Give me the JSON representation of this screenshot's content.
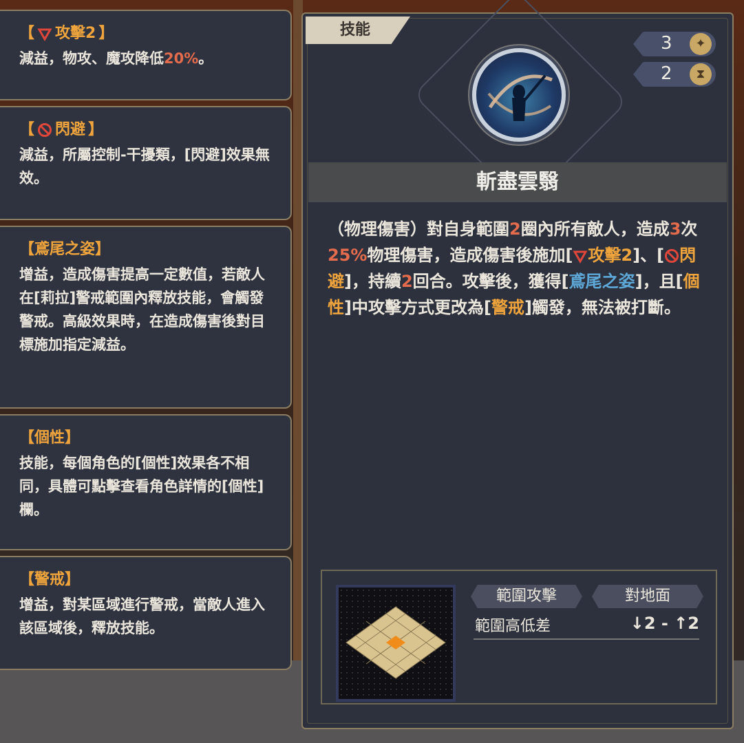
{
  "tooltips": [
    {
      "title_pre": "【",
      "title": "攻擊2",
      "title_post": "】",
      "icon": "down-triangle-icon",
      "body_a": "減益，物攻、魔攻降低",
      "body_hl": "20%",
      "body_b": "。"
    },
    {
      "title_pre": "【",
      "title": "閃避",
      "title_post": "】",
      "icon": "prohibit-icon",
      "body": "減益，所屬控制-干擾類，[閃避]效果無效。"
    },
    {
      "title": "【鳶尾之姿】",
      "body": "增益，造成傷害提高一定數值，若敵人在[莉拉]警戒範圍內釋放技能，會觸發警戒。高級效果時，在造成傷害後對目標施加指定減益。"
    },
    {
      "title": "【個性】",
      "body": "技能，每個角色的[個性]效果各不相同，具體可點擊查看角色詳情的[個性]欄。"
    },
    {
      "title": "【警戒】",
      "body": "增益，對某區域進行警戒，當敵人進入該區域後，釋放技能。"
    }
  ],
  "panel": {
    "tab": "技能",
    "cost_ap": "3",
    "cost_turns": "2",
    "skill_name": "斬盡雲翳",
    "desc": {
      "p1": "（物理傷害）對自身範圍",
      "n1": "2",
      "p2": "圈內所有敵人，造成",
      "n2": "3",
      "p3": "次",
      "n3": "25%",
      "p4": "物理傷害，造成傷害後施加[",
      "s1": "攻擊2",
      "p5": "]、[",
      "s2": "閃避",
      "p6": "]，持續",
      "n4": "2",
      "p7": "回合。攻擊後，獲得[",
      "s3": "鳶尾之姿",
      "p8": "]，且[",
      "s4": "個性",
      "p9": "]中攻擊方式更改為[",
      "s5": "警戒",
      "p10": "]觸發，無法被打斷。"
    },
    "range": {
      "tag1": "範圍攻擊",
      "tag2": "對地面",
      "label": "範圍高低差",
      "value": "↓2 - ↑2"
    }
  }
}
